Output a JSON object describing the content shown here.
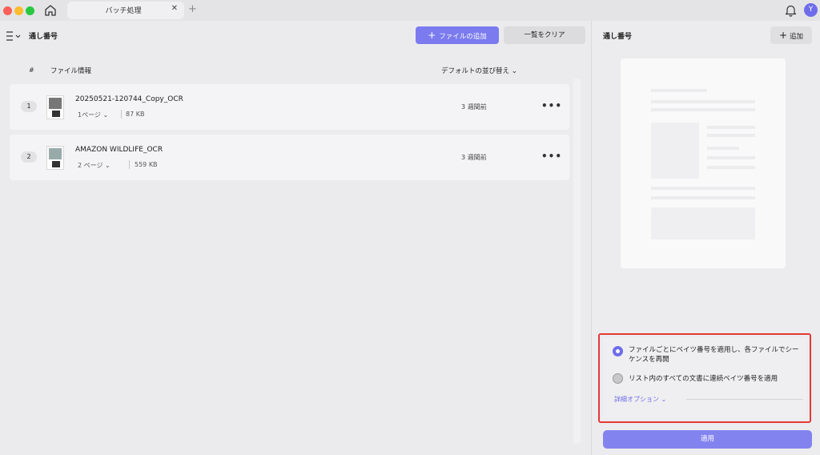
{
  "window": {
    "tab_title": "バッチ処理",
    "tab_close": "✕",
    "new_tab": "+",
    "avatar_letter": "Y"
  },
  "toolbar": {
    "title": "通し番号",
    "add_file_label": "ファイルの追加",
    "clear_label": "一覧をクリア"
  },
  "table": {
    "col_number": "#",
    "col_info": "ファイル情報",
    "sort_label": "デフォルトの並び替え ⌄",
    "rows": [
      {
        "index": "1",
        "name": "20250521-120744_Copy_OCR",
        "pages": "1ページ ⌄",
        "size": "87 KB",
        "modified": "3 週間前",
        "more": "•••"
      },
      {
        "index": "2",
        "name": "AMAZON WILDLIFE_OCR",
        "pages": "2 ページ ⌄",
        "size": "559 KB",
        "modified": "3 週間前",
        "more": "•••"
      }
    ]
  },
  "right_panel": {
    "title": "通し番号",
    "add_label": "追加",
    "option1": "ファイルごとにベイツ番号を適用し、各ファイルでシーケンスを再開",
    "option2": "リスト内のすべての文書に連続ベイツ番号を適用",
    "option1_selected": true,
    "advanced_label": "詳細オプション ⌄",
    "apply_label": "適用"
  },
  "colors": {
    "accent": "#7b7bef",
    "highlight_border": "#e53935"
  }
}
